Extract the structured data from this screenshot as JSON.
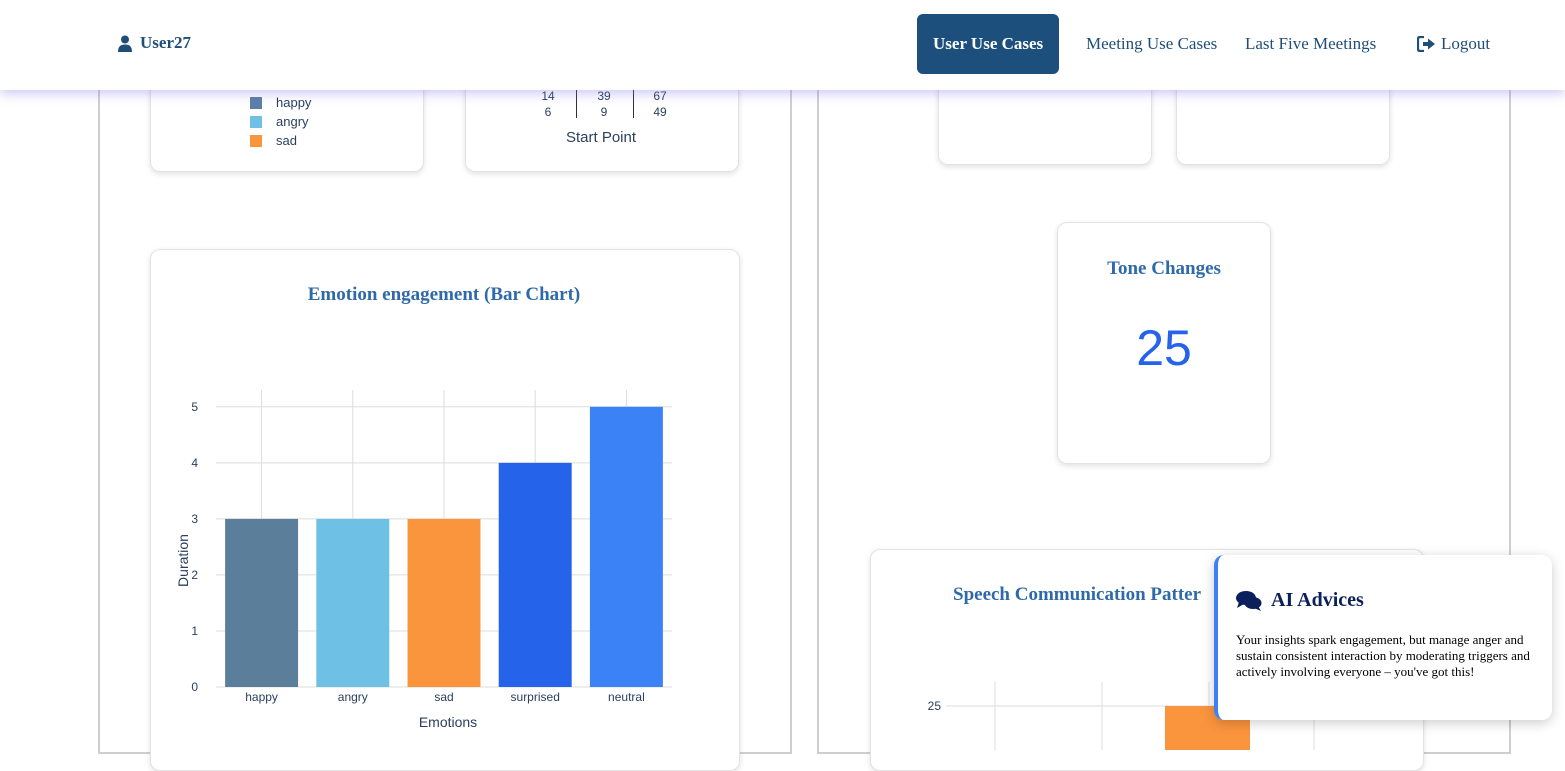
{
  "navbar": {
    "user": "User27",
    "items": [
      "User Use Cases",
      "Meeting Use Cases",
      "Last Five Meetings"
    ],
    "logout": "Logout"
  },
  "legend_card": {
    "items": [
      {
        "label": "happy",
        "color": "#5b7fa6"
      },
      {
        "label": "angry",
        "color": "#6ec0e4"
      },
      {
        "label": "sad",
        "color": "#fa943d"
      }
    ]
  },
  "table_card": {
    "rows": [
      [
        "14",
        "39",
        "67"
      ],
      [
        "6",
        "9",
        "49"
      ]
    ],
    "axis_label": "Start Point"
  },
  "tone_card": {
    "title": "Tone Changes",
    "value": "25"
  },
  "speech_card": {
    "title": "Speech Communication Patter",
    "y_tick": "25"
  },
  "ai_advice": {
    "title": "AI Advices",
    "text": "Your insights spark engagement, but manage anger and sustain consistent interaction by moderating triggers and actively involving everyone – you've got this!"
  },
  "chart_data": {
    "type": "bar",
    "title": "Emotion engagement (Bar Chart)",
    "categories": [
      "happy",
      "angry",
      "sad",
      "surprised",
      "neutral"
    ],
    "values": [
      3,
      3,
      3,
      4,
      5
    ],
    "colors": [
      "#5b7f9b",
      "#6ec0e4",
      "#fa943d",
      "#2563eb",
      "#3b82f6"
    ],
    "xlabel": "Emotions",
    "ylabel": "Duration",
    "ylim": [
      0,
      5.3
    ],
    "yticks": [
      0,
      1,
      2,
      3,
      4,
      5
    ],
    "grid": true
  }
}
